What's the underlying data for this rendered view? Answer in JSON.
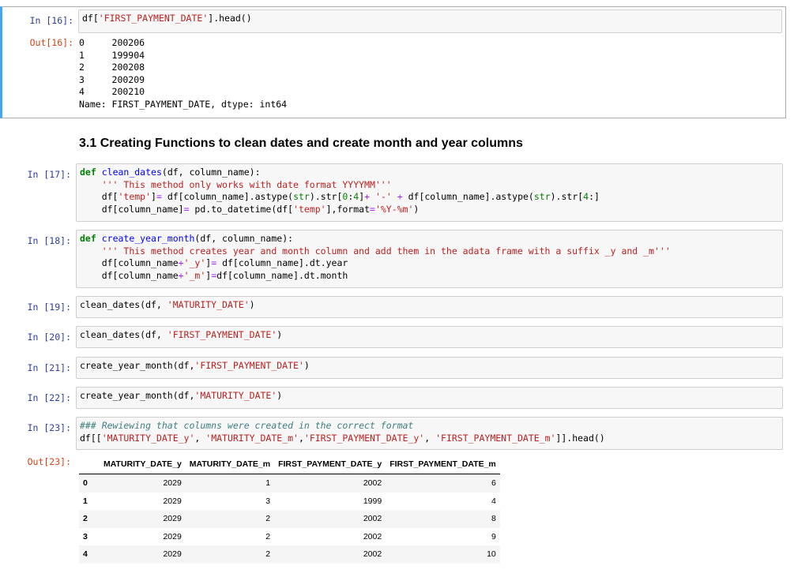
{
  "cells": {
    "c16": {
      "in_prompt": "In [16]:",
      "out_prompt": "Out[16]:",
      "output_lines": [
        "0     200206",
        "1     199904",
        "2     200208",
        "3     200209",
        "4     200210",
        "Name: FIRST_PAYMENT_DATE, dtype: int64"
      ]
    },
    "md": {
      "heading": "3.1 Creating Functions to clean dates and create month and year columns"
    },
    "c17": {
      "in_prompt": "In [17]:"
    },
    "c18": {
      "in_prompt": "In [18]:"
    },
    "c19": {
      "in_prompt": "In [19]:"
    },
    "c20": {
      "in_prompt": "In [20]:"
    },
    "c21": {
      "in_prompt": "In [21]:"
    },
    "c22": {
      "in_prompt": "In [22]:"
    },
    "c23": {
      "in_prompt": "In [23]:",
      "out_prompt": "Out[23]:"
    }
  },
  "code_lines": [
    {
      "id": "c16",
      "tokens": [
        [
          "df[",
          ""
        ],
        [
          "'FIRST_PAYMENT_DATE'",
          "str"
        ],
        [
          "].head()",
          ""
        ]
      ]
    },
    {
      "id": "c17",
      "tokens": [
        [
          "def",
          "kw"
        ],
        [
          " ",
          ""
        ],
        [
          "clean_dates",
          "fn"
        ],
        [
          "(df, column_name):",
          ""
        ]
      ]
    },
    {
      "id": "c17",
      "tokens": [
        [
          "    ",
          ""
        ],
        [
          "''' This method only works with date format YYYYMM'''",
          "str"
        ]
      ]
    },
    {
      "id": "c17",
      "tokens": [
        [
          "    df[",
          ""
        ],
        [
          "'temp'",
          "str"
        ],
        [
          "]",
          ""
        ],
        [
          "=",
          "op"
        ],
        [
          " df[column_name].astype(",
          ""
        ],
        [
          "str",
          "bi"
        ],
        [
          ").str[",
          ""
        ],
        [
          "0",
          "num"
        ],
        [
          ":",
          ""
        ],
        [
          "4",
          "num"
        ],
        [
          "]",
          ""
        ],
        [
          "+",
          "op"
        ],
        [
          " ",
          ""
        ],
        [
          "'-'",
          "str"
        ],
        [
          " ",
          ""
        ],
        [
          "+",
          "op"
        ],
        [
          " df[column_name].astype(",
          ""
        ],
        [
          "str",
          "bi"
        ],
        [
          ").str[",
          ""
        ],
        [
          "4",
          "num"
        ],
        [
          ":]",
          ""
        ]
      ]
    },
    {
      "id": "c17",
      "tokens": [
        [
          "    df[column_name]",
          ""
        ],
        [
          "=",
          "op"
        ],
        [
          " pd.to_datetime(df[",
          ""
        ],
        [
          "'temp'",
          "str"
        ],
        [
          "],format",
          ""
        ],
        [
          "=",
          "op"
        ],
        [
          "'%Y-%m'",
          "str"
        ],
        [
          ")",
          ""
        ]
      ]
    },
    {
      "id": "c18",
      "tokens": [
        [
          "def",
          "kw"
        ],
        [
          " ",
          ""
        ],
        [
          "create_year_month",
          "fn"
        ],
        [
          "(df, column_name):",
          ""
        ]
      ]
    },
    {
      "id": "c18",
      "tokens": [
        [
          "    ",
          ""
        ],
        [
          "''' This method creates year and month column and add them in the adata frame with a suffix _y and _m'''",
          "str"
        ]
      ]
    },
    {
      "id": "c18",
      "tokens": [
        [
          "    df[column_name",
          ""
        ],
        [
          "+",
          "op"
        ],
        [
          "'_y'",
          "str"
        ],
        [
          "]",
          ""
        ],
        [
          "=",
          "op"
        ],
        [
          " df[column_name].dt.year",
          ""
        ]
      ]
    },
    {
      "id": "c18",
      "tokens": [
        [
          "    df[column_name",
          ""
        ],
        [
          "+",
          "op"
        ],
        [
          "'_m'",
          "str"
        ],
        [
          "]",
          ""
        ],
        [
          "=",
          "op"
        ],
        [
          "df[column_name].dt.month",
          ""
        ]
      ]
    },
    {
      "id": "c19",
      "tokens": [
        [
          "clean_dates(df, ",
          ""
        ],
        [
          "'MATURITY_DATE'",
          "str"
        ],
        [
          ")",
          ""
        ]
      ]
    },
    {
      "id": "c20",
      "tokens": [
        [
          "clean_dates(df, ",
          ""
        ],
        [
          "'FIRST_PAYMENT_DATE'",
          "str"
        ],
        [
          ")",
          ""
        ]
      ]
    },
    {
      "id": "c21",
      "tokens": [
        [
          "create_year_month(df,",
          ""
        ],
        [
          "'FIRST_PAYMENT_DATE'",
          "str"
        ],
        [
          ")",
          ""
        ]
      ]
    },
    {
      "id": "c22",
      "tokens": [
        [
          "create_year_month(df,",
          ""
        ],
        [
          "'MATURITY_DATE'",
          "str"
        ],
        [
          ")",
          ""
        ]
      ]
    },
    {
      "id": "c23",
      "tokens": [
        [
          "### Rewiewing that columns were created in the correct format",
          "cm"
        ]
      ]
    },
    {
      "id": "c23",
      "tokens": [
        [
          "df[[",
          ""
        ],
        [
          "'MATURITY_DATE_y'",
          "str"
        ],
        [
          ", ",
          ""
        ],
        [
          "'MATURITY_DATE_m'",
          "str"
        ],
        [
          ",",
          ""
        ],
        [
          "'FIRST_PAYMENT_DATE_y'",
          "str"
        ],
        [
          ", ",
          ""
        ],
        [
          "'FIRST_PAYMENT_DATE_m'",
          "str"
        ],
        [
          "]].head()",
          ""
        ]
      ]
    }
  ],
  "dataframe": {
    "columns": [
      "",
      "MATURITY_DATE_y",
      "MATURITY_DATE_m",
      "FIRST_PAYMENT_DATE_y",
      "FIRST_PAYMENT_DATE_m"
    ],
    "rows": [
      [
        "0",
        "2029",
        "1",
        "2002",
        "6"
      ],
      [
        "1",
        "2029",
        "3",
        "1999",
        "4"
      ],
      [
        "2",
        "2029",
        "2",
        "2002",
        "8"
      ],
      [
        "3",
        "2029",
        "2",
        "2002",
        "9"
      ],
      [
        "4",
        "2029",
        "2",
        "2002",
        "10"
      ]
    ]
  }
}
